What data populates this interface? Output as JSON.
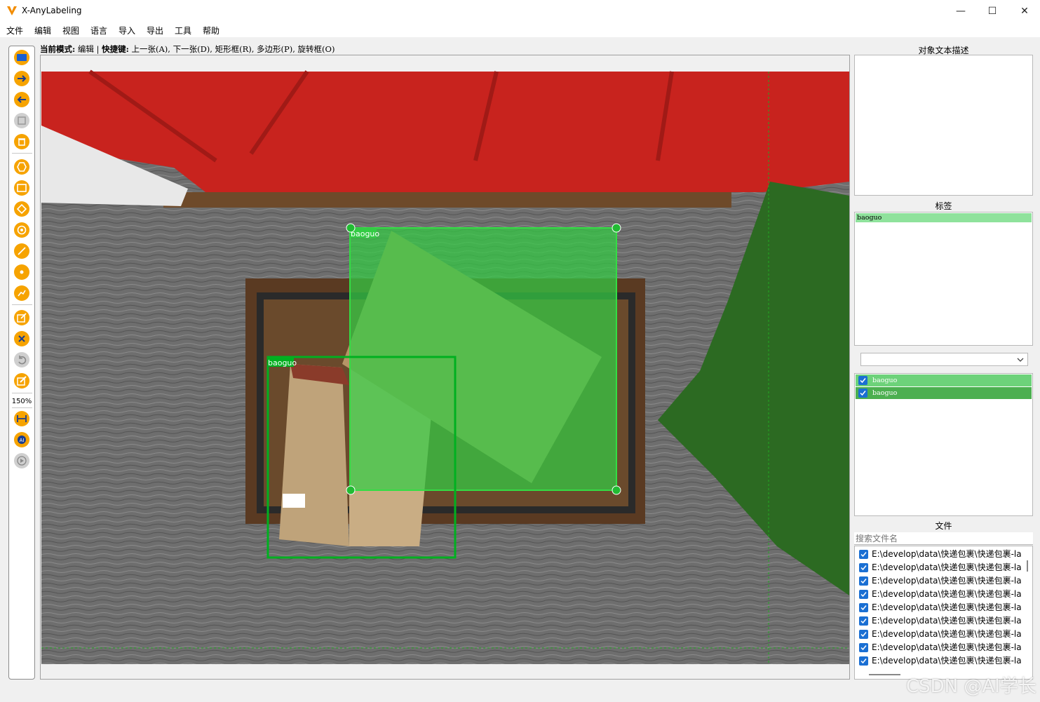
{
  "window": {
    "title": "X-AnyLabeling",
    "minimize": "—",
    "maximize": "☐",
    "close": "✕"
  },
  "menu": [
    "文件",
    "编辑",
    "视图",
    "语言",
    "导入",
    "导出",
    "工具",
    "帮助"
  ],
  "mode_bar": {
    "mode_label": "当前模式:",
    "mode_value": "编辑",
    "sep": "|",
    "shortcut_label": "快捷键:",
    "shortcut_value": "上一张(A), 下一张(D), 矩形框(R), 多边形(P), 旋转框(O)"
  },
  "toolbar": {
    "zoom": "150%",
    "tools": [
      "open-dir-icon",
      "next-image-icon",
      "prev-image-icon",
      "save-icon",
      "delete-icon",
      "polygon-icon",
      "rectangle-icon",
      "rotation-icon",
      "circle-icon",
      "line-icon",
      "point-icon",
      "linestrip-icon",
      "edit-icon",
      "close-shape-icon",
      "undo-icon",
      "brush-icon",
      "fit-width-icon",
      "ai-icon",
      "play-icon"
    ]
  },
  "canvas": {
    "shapes": [
      {
        "label": "baoguo",
        "selected": true
      },
      {
        "label": "baoguo",
        "selected": false
      }
    ]
  },
  "right_panel": {
    "description_title": "对象文本描述",
    "labels_title": "标签",
    "labels": [
      "baoguo"
    ],
    "shapes_list": [
      {
        "label": "baoguo",
        "checked": true
      },
      {
        "label": "baoguo",
        "checked": true
      }
    ],
    "files_title": "文件",
    "file_search_placeholder": "搜索文件名",
    "files": [
      "E:\\develop\\data\\快递包裹\\快递包裹-la",
      "E:\\develop\\data\\快递包裹\\快递包裹-la",
      "E:\\develop\\data\\快递包裹\\快递包裹-la",
      "E:\\develop\\data\\快递包裹\\快递包裹-la",
      "E:\\develop\\data\\快递包裹\\快递包裹-la",
      "E:\\develop\\data\\快递包裹\\快递包裹-la",
      "E:\\develop\\data\\快递包裹\\快递包裹-la",
      "E:\\develop\\data\\快递包裹\\快递包裹-la",
      "E:\\develop\\data\\快递包裹\\快递包裹-la"
    ]
  },
  "overlay": {
    "watermark": "CSDN @AI学长"
  },
  "colors": {
    "accent": "#f6a300",
    "shape_green": "#00c020",
    "label_highlight": "#8fe29c",
    "selected_row": "#4caf50"
  }
}
